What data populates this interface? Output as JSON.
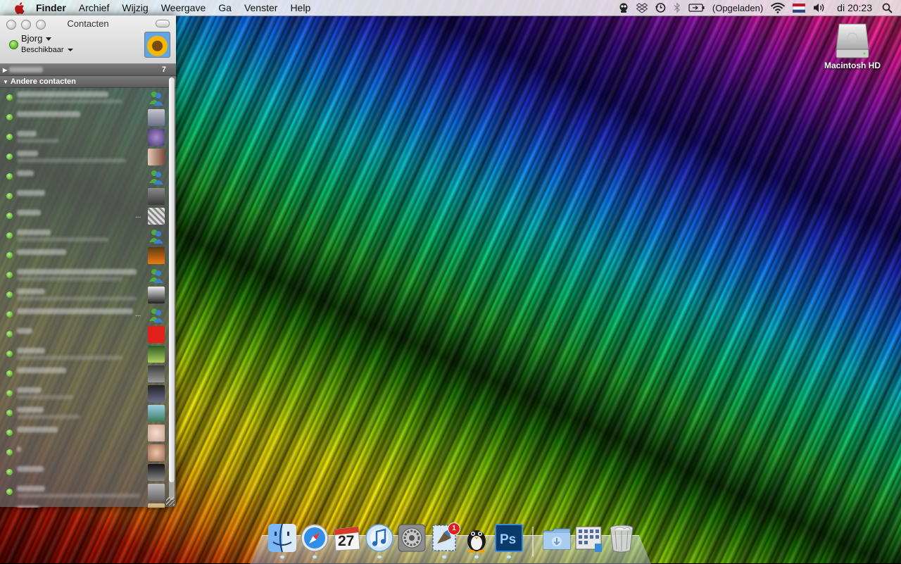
{
  "menubar": {
    "app_name": "Finder",
    "menus": [
      "Archief",
      "Wijzig",
      "Weergave",
      "Ga",
      "Venster",
      "Help"
    ],
    "battery_status": "(Opgeladen)",
    "clock": "di 20:23"
  },
  "contacts_window": {
    "title": "Contacten",
    "user_name": "Bjorg",
    "user_status": "Beschikbaar",
    "groups": [
      {
        "count": "7"
      },
      {
        "label": "Andere contacten"
      }
    ]
  },
  "desktop": {
    "drive_label": "Macintosh HD"
  },
  "dock": {
    "mail_badge": "1",
    "calendar_day": "27"
  },
  "icons": {
    "apple": "apple-logo",
    "tray": [
      "adium-icon",
      "dropbox-icon",
      "time-machine-icon",
      "bluetooth-icon",
      "battery-icon",
      "wifi-icon",
      "flag-icon",
      "volume-icon",
      "spotlight-icon"
    ],
    "dock": [
      "finder",
      "safari",
      "ical",
      "itunes",
      "system-preferences",
      "mail",
      "adium",
      "photoshop",
      "downloads-folder",
      "applications-folder",
      "trash"
    ]
  },
  "colors": {
    "status_available": "#3c9a0c"
  }
}
